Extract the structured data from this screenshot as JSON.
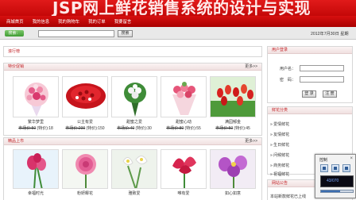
{
  "banner": {
    "title": "JSP网上鲜花销售系统的设计与实现"
  },
  "nav": {
    "items": [
      "商城首页",
      "我的信息",
      "我的购物车",
      "我的订单",
      "我要留言"
    ]
  },
  "search": {
    "login_label": "搜索：",
    "button": "搜索",
    "date": "2012年7月30日 星期"
  },
  "news_panel": {
    "title": "滚行榜"
  },
  "featured": {
    "title": "特价促销",
    "more": "更多>>",
    "items": [
      {
        "name": "繁华梦里",
        "price_old": "市场价:50",
        "price_new": "(特价):18"
      },
      {
        "name": "公主有爱",
        "price_old": "市场价:200",
        "price_new": "(特价):150"
      },
      {
        "name": "甜蜜之爱",
        "price_old": "市场价:40",
        "price_new": "(特价):30"
      },
      {
        "name": "甜蜜心动",
        "price_old": "市场价:80",
        "price_new": "(特价):55"
      },
      {
        "name": "满园郁金",
        "price_old": "市场价:50",
        "price_new": "(特价):45"
      }
    ]
  },
  "new_items": {
    "title": "精品上市",
    "more": "更多>>",
    "items": [
      {
        "name": "幸福时光"
      },
      {
        "name": "粉妍椰花"
      },
      {
        "name": "雅致爱"
      },
      {
        "name": "唯有爱"
      },
      {
        "name": "如心如意"
      }
    ]
  },
  "user_panel": {
    "title": "用户登录",
    "username_label": "用户名：",
    "password_label": "密　码：",
    "login_button": "登 录",
    "register_button": "注 册"
  },
  "category_panel": {
    "title": "鲜花分类",
    "items": [
      "» 爱情鲜花",
      "» 友情鲜花",
      "» 生日鲜花",
      "» 问候鲜花",
      "» 商务鲜花",
      "» 祝福鲜花"
    ]
  },
  "notice_panel": {
    "title": "网站公告",
    "item": "本站新款鲜花已上线"
  },
  "video_control": {
    "title": "控制",
    "time": "43/070"
  },
  "colors": {
    "brand_red": "#d01010",
    "panel_title": "#c2262a"
  }
}
